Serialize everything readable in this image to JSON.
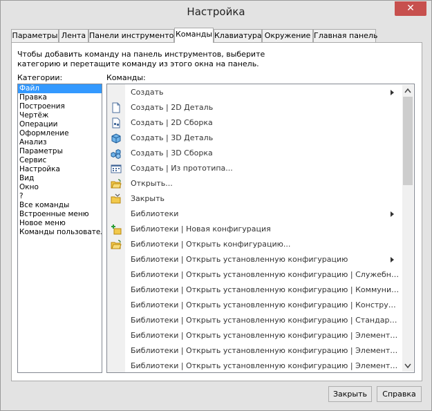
{
  "window": {
    "title": "Настройка",
    "close_glyph": "✕"
  },
  "tabs": [
    {
      "label": "Параметры",
      "active": false
    },
    {
      "label": "Лента",
      "active": false
    },
    {
      "label": "Панели инструментов",
      "active": false
    },
    {
      "label": "Команды",
      "active": true
    },
    {
      "label": "Клавиатура",
      "active": false
    },
    {
      "label": "Окружение",
      "active": false
    },
    {
      "label": "Главная панель",
      "active": false
    }
  ],
  "instructions": {
    "line1": "Чтобы добавить команду на панель инструментов, выберите",
    "line2": "категорию и перетащите команду из этого окна на панель."
  },
  "categories": {
    "label": "Категории:",
    "selected": "Файл",
    "items": [
      "Файл",
      "Правка",
      "Построения",
      "Чертёж",
      "Операции",
      "Оформление",
      "Анализ",
      "Параметры",
      "Сервис",
      "Настройка",
      "Вид",
      "Окно",
      "?",
      "Все команды",
      "Встроенные меню",
      "Новое меню",
      "Команды пользователя"
    ]
  },
  "commands": {
    "label": "Команды:",
    "items": [
      {
        "label": "Создать",
        "icon": "none",
        "submenu": true
      },
      {
        "label": "Создать | 2D Деталь",
        "icon": "document-icon",
        "submenu": false
      },
      {
        "label": "Создать | 2D Сборка",
        "icon": "assembly-doc-icon",
        "submenu": false
      },
      {
        "label": "Создать | 3D Деталь",
        "icon": "cube-icon",
        "submenu": false
      },
      {
        "label": "Создать | 3D Сборка",
        "icon": "cubes-icon",
        "submenu": false
      },
      {
        "label": "Создать | Из прототипа...",
        "icon": "prototype-icon",
        "submenu": false
      },
      {
        "label": "Открыть...",
        "icon": "open-folder-icon",
        "submenu": false
      },
      {
        "label": "Закрыть",
        "icon": "close-folder-icon",
        "submenu": false
      },
      {
        "label": "Библиотеки",
        "icon": "none",
        "submenu": true
      },
      {
        "label": "Библиотеки | Новая конфигурация",
        "icon": "new-config-icon",
        "submenu": false
      },
      {
        "label": "Библиотеки | Открыть конфигурацию...",
        "icon": "open-folder-icon",
        "submenu": false
      },
      {
        "label": "Библиотеки | Открыть установленную конфигурацию",
        "icon": "none",
        "submenu": true
      },
      {
        "label": "Библиотеки | Открыть установленную конфигурацию | Служебные",
        "icon": "none",
        "submenu": false
      },
      {
        "label": "Библиотеки | Открыть установленную конфигурацию | Коммуникац...",
        "icon": "none",
        "submenu": false
      },
      {
        "label": "Библиотеки | Открыть установленную конфигурацию | Конструктив...",
        "icon": "none",
        "submenu": false
      },
      {
        "label": "Библиотеки | Открыть установленную конфигурацию | Стандартные ...",
        "icon": "none",
        "submenu": false
      },
      {
        "label": "Библиотеки | Открыть установленную конфигурацию | Элементы сх...",
        "icon": "none",
        "submenu": false
      },
      {
        "label": "Библиотеки | Открыть установленную конфигурацию | Элементы эл...",
        "icon": "none",
        "submenu": false
      },
      {
        "label": "Библиотеки | Открыть установленную конфигурацию | Элементы тр...",
        "icon": "none",
        "submenu": false
      }
    ]
  },
  "buttons": {
    "close": "Закрыть",
    "help": "Справка"
  },
  "colors": {
    "selection": "#3399ff",
    "close_button": "#c7504e"
  }
}
